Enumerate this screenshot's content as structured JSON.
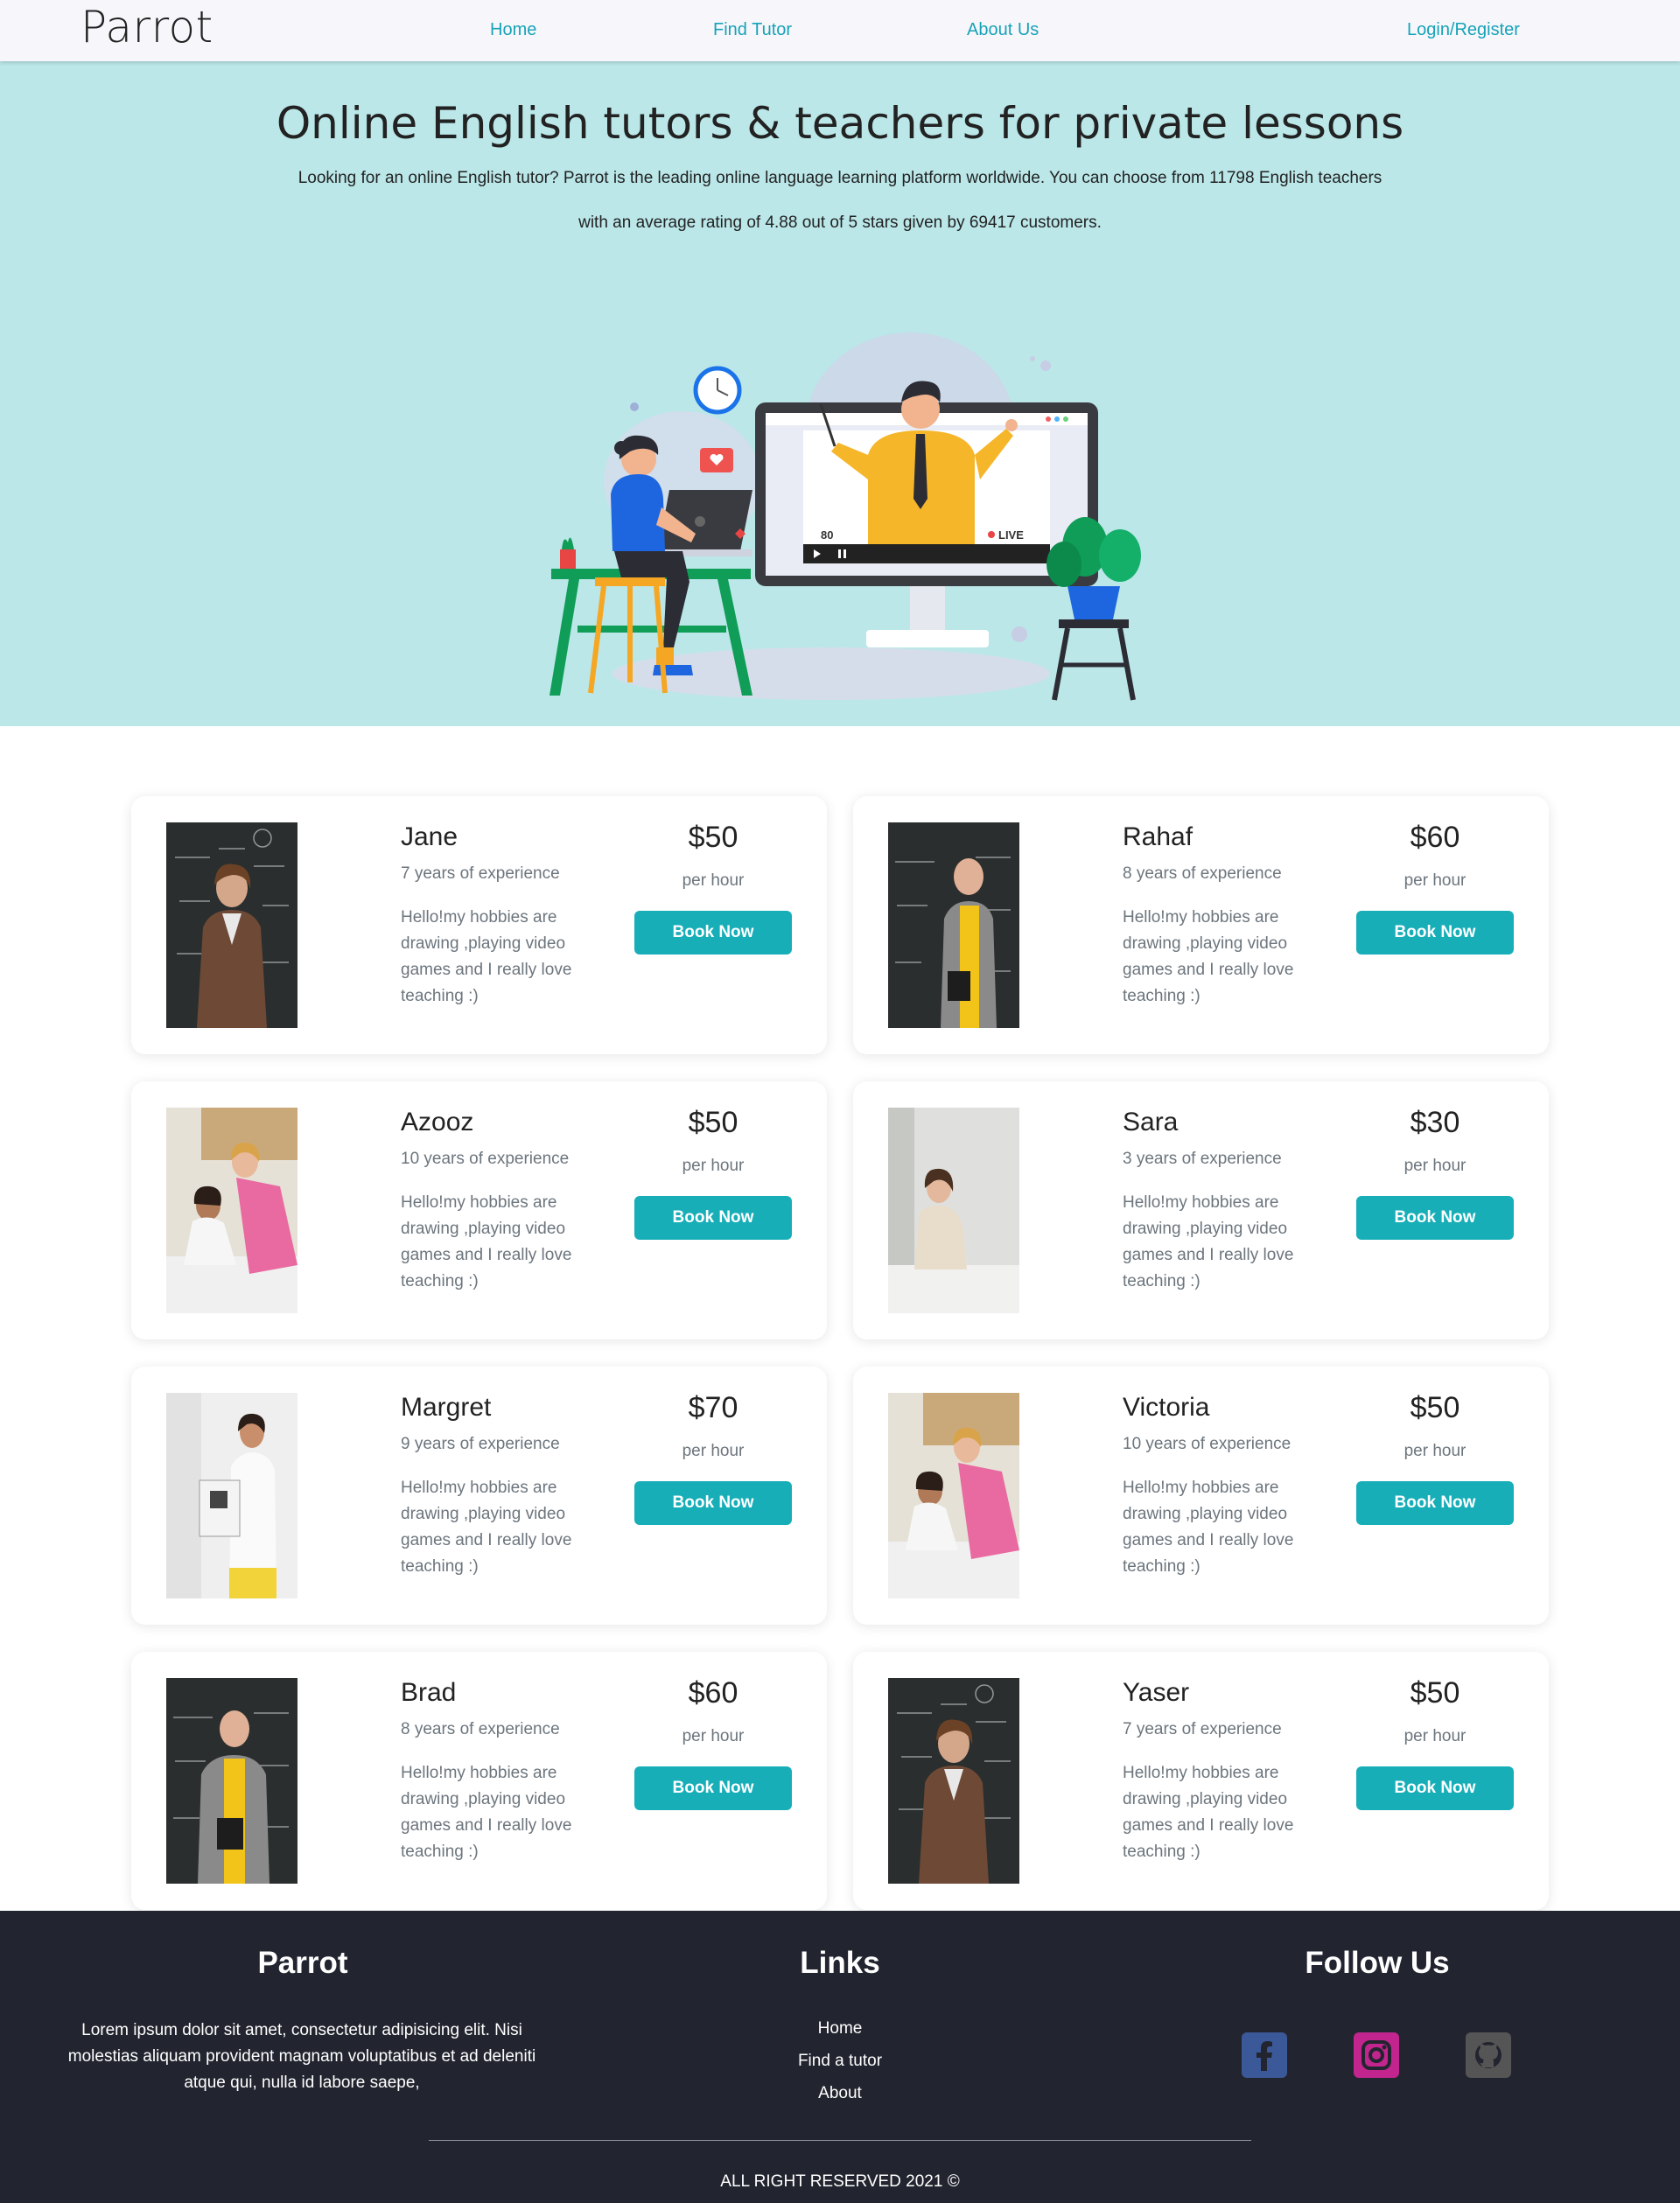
{
  "nav": {
    "brand": "Parrot",
    "home": "Home",
    "find_tutor": "Find Tutor",
    "about": "About Us",
    "login": "Login/Register"
  },
  "hero": {
    "title": "Online English tutors & teachers for private lessons",
    "description": "Looking for an online English tutor? Parrot is the leading online language learning platform worldwide. You can choose from 11798 English teachers with an average rating of 4.88 out of 5 stars given by 69417 customers.",
    "illustration": {
      "viewers": "80",
      "live_label": "LIVE"
    }
  },
  "tutors": [
    {
      "name": "Jane",
      "experience": "7 years of experience",
      "bio": "Hello!my hobbies are drawing ,playing video games and I really love teaching :)",
      "price": "$50",
      "per": "per hour",
      "button": "Book Now"
    },
    {
      "name": "Rahaf",
      "experience": "8 years of experience",
      "bio": "Hello!my hobbies are drawing ,playing video games and I really love teaching :)",
      "price": "$60",
      "per": "per hour",
      "button": "Book Now"
    },
    {
      "name": "Azooz",
      "experience": "10 years of experience",
      "bio": "Hello!my hobbies are drawing ,playing video games and I really love teaching :)",
      "price": "$50",
      "per": "per hour",
      "button": "Book Now"
    },
    {
      "name": "Sara",
      "experience": "3 years of experience",
      "bio": "Hello!my hobbies are drawing ,playing video games and I really love teaching :)",
      "price": "$30",
      "per": "per hour",
      "button": "Book Now"
    },
    {
      "name": "Margret",
      "experience": "9 years of experience",
      "bio": "Hello!my hobbies are drawing ,playing video games and I really love teaching :)",
      "price": "$70",
      "per": "per hour",
      "button": "Book Now"
    },
    {
      "name": "Victoria",
      "experience": "10 years of experience",
      "bio": "Hello!my hobbies are drawing ,playing video games and I really love teaching :)",
      "price": "$50",
      "per": "per hour",
      "button": "Book Now"
    },
    {
      "name": "Brad",
      "experience": "8 years of experience",
      "bio": "Hello!my hobbies are drawing ,playing video games and I really love teaching :)",
      "price": "$60",
      "per": "per hour",
      "button": "Book Now"
    },
    {
      "name": "Yaser",
      "experience": "7 years of experience",
      "bio": "Hello!my hobbies are drawing ,playing video games and I really love teaching :)",
      "price": "$50",
      "per": "per hour",
      "button": "Book Now"
    }
  ],
  "footer": {
    "brand_title": "Parrot",
    "brand_text": "Lorem ipsum dolor sit amet, consectetur adipisicing elit. Nisi molestias aliquam provident magnam voluptatibus et ad deleniti atque qui, nulla id labore saepe,",
    "links_title": "Links",
    "links": [
      "Home",
      "Find a tutor",
      "About"
    ],
    "follow_title": "Follow Us",
    "social": [
      "facebook-icon",
      "instagram-icon",
      "github-icon"
    ],
    "copyright": "ALL RIGHT RESERVED 2021 ©"
  },
  "colors": {
    "accent": "#17a2b8",
    "button": "#17aeb8",
    "hero_bg": "#bbe7e9",
    "footer_bg": "#22252f"
  }
}
